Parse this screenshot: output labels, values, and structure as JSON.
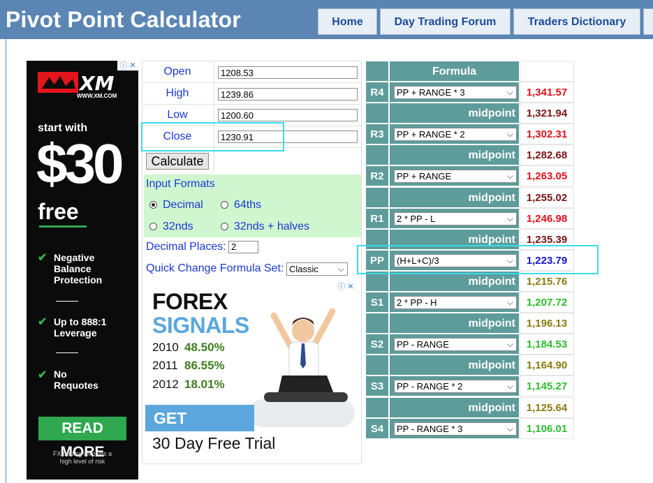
{
  "header": {
    "title": "Pivot Point Calculator",
    "nav": [
      "Home",
      "Day Trading Forum",
      "Traders Dictionary"
    ]
  },
  "ad_left": {
    "brand": "XM",
    "url": "WWW.XM.COM",
    "start": "start with",
    "amount": "$30",
    "free": "free",
    "features": [
      {
        "lines": [
          "Negative",
          "Balance",
          "Protection"
        ]
      },
      {
        "lines": [
          "Up to 888:1",
          "Leverage"
        ]
      },
      {
        "lines": [
          "No",
          "Requotes"
        ]
      }
    ],
    "cta": "READ MORE",
    "disclaimer_line1": "FX trading involves a",
    "disclaimer_line2": "high level of risk"
  },
  "form": {
    "open_label": "Open",
    "open_value": "1208.53",
    "high_label": "High",
    "high_value": "1239.86",
    "low_label": "Low",
    "low_value": "1200.60",
    "close_label": "Close",
    "close_value": "1230.91",
    "calculate": "Calculate",
    "input_formats": "Input Formats",
    "formats": [
      {
        "label": "Decimal",
        "checked": true
      },
      {
        "label": "64ths",
        "checked": false
      },
      {
        "label": "32nds",
        "checked": false
      },
      {
        "label": "32nds + halves",
        "checked": false
      }
    ],
    "decimal_places_label": "Decimal Places:",
    "decimal_places_value": "2",
    "formula_set_label": "Quick Change Formula Set:",
    "formula_set_value": "Classic"
  },
  "ad_forex": {
    "title": "FOREX",
    "subtitle": "SIGNALS",
    "stats": [
      {
        "year": "2010",
        "pct": "48.50%"
      },
      {
        "year": "2011",
        "pct": "86.55%"
      },
      {
        "year": "2012",
        "pct": "18.01%"
      }
    ],
    "cta": "GET STARTED",
    "trial": "30 Day Free Trial"
  },
  "table": {
    "header": "Formula",
    "midpoint_label": "midpoint",
    "rows": [
      {
        "level": "R4",
        "formula": "PP + RANGE * 3",
        "value": "1,341.57",
        "color": "#e0101a"
      },
      {
        "mid": "1,321.94",
        "color": "#7a1212"
      },
      {
        "level": "R3",
        "formula": "PP + RANGE * 2",
        "value": "1,302.31",
        "color": "#e0101a"
      },
      {
        "mid": "1,282.68",
        "color": "#7a1212"
      },
      {
        "level": "R2",
        "formula": "PP + RANGE",
        "value": "1,263.05",
        "color": "#e0101a"
      },
      {
        "mid": "1,255.02",
        "color": "#7a1212"
      },
      {
        "level": "R1",
        "formula": "2 * PP - L",
        "value": "1,246.98",
        "color": "#e0101a"
      },
      {
        "mid": "1,235.39",
        "color": "#7a1212"
      },
      {
        "level": "PP",
        "formula": "(H+L+C)/3",
        "value": "1,223.79",
        "color": "#1515c8"
      },
      {
        "mid": "1,215.76",
        "color": "#8a7a10"
      },
      {
        "level": "S1",
        "formula": "2 * PP - H",
        "value": "1,207.72",
        "color": "#2dbb2d"
      },
      {
        "mid": "1,196.13",
        "color": "#8a7a10"
      },
      {
        "level": "S2",
        "formula": "PP - RANGE",
        "value": "1,184.53",
        "color": "#2dbb2d"
      },
      {
        "mid": "1,164.90",
        "color": "#8a7a10"
      },
      {
        "level": "S3",
        "formula": "PP - RANGE * 2",
        "value": "1,145.27",
        "color": "#2dbb2d"
      },
      {
        "mid": "1,125.64",
        "color": "#8a7a10"
      },
      {
        "level": "S4",
        "formula": "PP - RANGE * 3",
        "value": "1,106.01",
        "color": "#2dbb2d"
      }
    ]
  }
}
